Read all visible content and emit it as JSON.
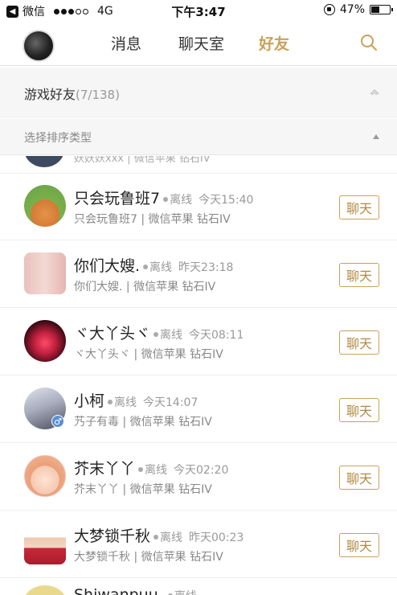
{
  "status_bar": {
    "carrier": "微信",
    "network": "4G",
    "time": "下午3:47",
    "battery": "47%",
    "battery_level": 0.47
  },
  "nav": {
    "tabs": [
      {
        "label": "消息",
        "active": false
      },
      {
        "label": "聊天室",
        "active": false
      },
      {
        "label": "好友",
        "active": true
      }
    ],
    "accent_color": "#c9a15a"
  },
  "group": {
    "title": "游戏好友",
    "count": "(7/138)"
  },
  "sort": {
    "label": "选择排序类型"
  },
  "friends_partial_top": {
    "subtitle": "妖妖妖xxx | 微信苹果 钻石IV"
  },
  "friends": [
    {
      "name": "只会玩鲁班7",
      "status": "离线",
      "time": "今天15:40",
      "subtitle": "只会玩鲁班7 | 微信苹果 钻石IV",
      "chat_label": "聊天"
    },
    {
      "name": "你们大嫂.",
      "status": "离线",
      "time": "昨天23:18",
      "subtitle": "你们大嫂. | 微信苹果 钻石IV",
      "chat_label": "聊天"
    },
    {
      "name": "ヾ大丫头ヾ",
      "status": "离线",
      "time": "今天08:11",
      "subtitle": "ヾ大丫头ヾ | 微信苹果 钻石IV",
      "chat_label": "聊天"
    },
    {
      "name": "小柯",
      "status": "离线",
      "time": "今天14:07",
      "subtitle": "艿子有毒 | 微信苹果 钻石IV",
      "chat_label": "聊天",
      "gender": "♂"
    },
    {
      "name": "芥末丫丫",
      "status": "离线",
      "time": "今天02:20",
      "subtitle": "芥末丫丫 | 微信苹果 钻石IV",
      "chat_label": "聊天"
    },
    {
      "name": "大梦锁千秋",
      "status": "离线",
      "time": "昨天00:23",
      "subtitle": "大梦锁千秋 | 微信苹果 钻石IV",
      "chat_label": "聊天"
    }
  ],
  "friends_partial_bottom": {
    "name": "Shiwanpuu",
    "status": "离线"
  }
}
